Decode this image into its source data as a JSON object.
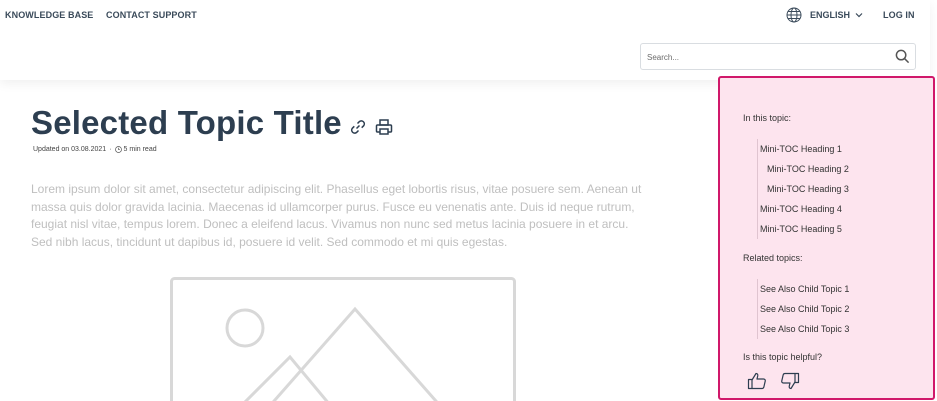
{
  "header": {
    "nav": [
      "Knowledge Base",
      "Contact Support"
    ],
    "language": "English",
    "login": "Log in",
    "search_placeholder": "Search..."
  },
  "topic": {
    "title": "Selected Topic Title",
    "updated": "Updated on 03.08.2021",
    "separator": "·",
    "read_time": "5 min read",
    "body": "Lorem ipsum dolor sit amet, consectetur adipiscing elit. Phasellus eget lobortis risus, vitae posuere sem. Aenean ut massa quis dolor gravida lacinia. Maecenas id ullamcorper purus. Fusce eu venenatis ante. Duis id neque rutrum, feugiat nisl vitae, tempus lorem. Donec a eleifend lacus. Vivamus non nunc sed metus lacinia posuere in et arcu. Sed nibh lacus, tincidunt ut dapibus id, posuere id velit. Sed commodo et mi quis egestas."
  },
  "sidebar": {
    "in_this_topic": "In this topic:",
    "mini_toc": [
      {
        "label": "Mini-TOC Heading 1",
        "level": 1
      },
      {
        "label": "Mini-TOC Heading 2",
        "level": 2
      },
      {
        "label": "Mini-TOC Heading 3",
        "level": 2
      },
      {
        "label": "Mini-TOC Heading 4",
        "level": 1
      },
      {
        "label": "Mini-TOC Heading 5",
        "level": 1
      }
    ],
    "related_topics": "Related topics:",
    "related": [
      "See Also Child Topic 1",
      "See Also Child Topic 2",
      "See Also Child Topic 3"
    ],
    "helpful": "Is this topic helpful?"
  },
  "colors": {
    "panel_bg": "#fde4ee",
    "panel_border": "#d0186a",
    "title": "#2d3e50",
    "body_text": "#bfbfbf"
  },
  "icons": [
    "globe-icon",
    "chevron-down-icon",
    "search-icon",
    "link-icon",
    "print-icon",
    "clock-icon",
    "image-placeholder-icon",
    "thumbs-up-icon",
    "thumbs-down-icon"
  ]
}
